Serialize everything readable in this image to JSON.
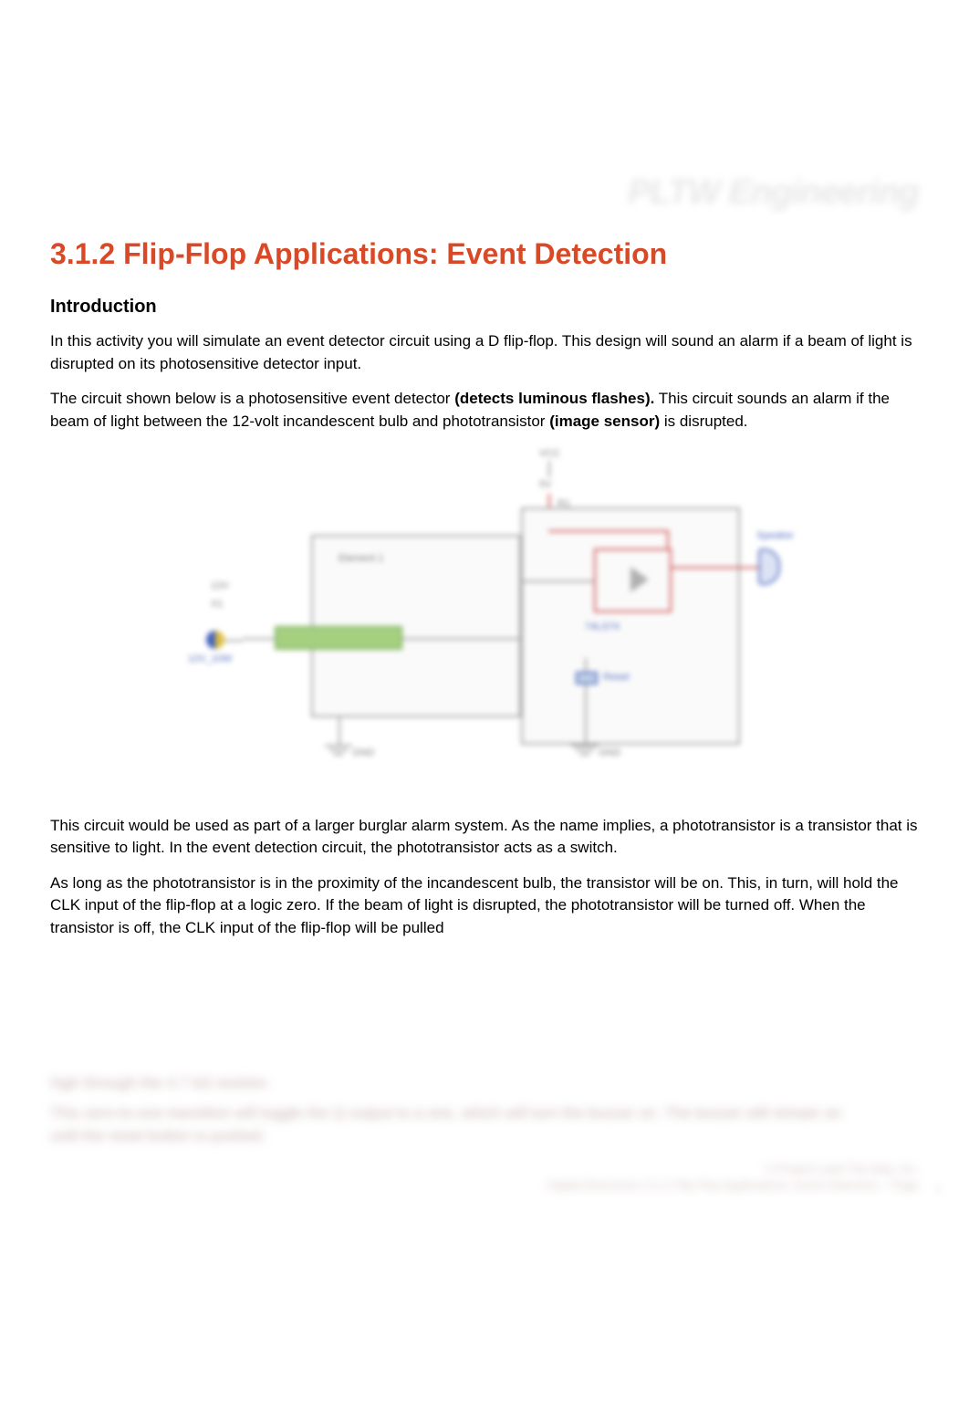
{
  "brand_watermark": "PLTW Engineering",
  "title": "3.1.2 Flip-Flop Applications: Event Detection",
  "intro_heading": "Introduction",
  "para1": "In this activity you will simulate an event detector circuit using a D flip-flop. This design will sound an alarm if a beam of light is disrupted on its photosensitive detector input.",
  "para2a": "The circuit shown below is a photosensitive event detector ",
  "para2b_bold": "(detects luminous flashes).",
  "para2c": " This circuit sounds an alarm if the beam of light between the 12-volt incandescent bulb and phototransistor ",
  "para2d_bold": "(image sensor)",
  "para2e": " is disrupted.",
  "circuit": {
    "vcc_top": "VCC",
    "r1": "R1",
    "five_v": "5V",
    "twelve_v": "12V",
    "x1": "X1",
    "lamp": "12V_10W",
    "gnd1": "GND",
    "gnd2": "GND",
    "element1": "Element 1",
    "reset": "Reset",
    "ff_part": "74LS74",
    "speaker": "Speaker"
  },
  "para3": "This circuit would be used as part of a larger burglar alarm system. As the name implies, a phototransistor is a transistor that is sensitive to light. In the event detection circuit, the phototransistor acts as a switch.",
  "para4": "As long as the phototransistor is in the proximity of the incandescent bulb, the transistor will be on. This, in turn, will hold the CLK input of the flip-flop at a logic zero. If the beam of light is disrupted, the phototransistor will be turned off. When the transistor is off, the CLK input of the flip-flop will be pulled",
  "blurred_line1": "high through the 4.7 kΩ resistor.",
  "blurred_line2": "This zero-to-one transition will toggle the Q output to a one, which will turn the buzzer on. The buzzer will remain on until the reset button is pushed.",
  "footer1": "© Project Lead The Way, Inc.",
  "footer2": "Digital Electronics 3.1.2 Flip-Flop Applications: Event Detection – Page",
  "page_number": "1"
}
